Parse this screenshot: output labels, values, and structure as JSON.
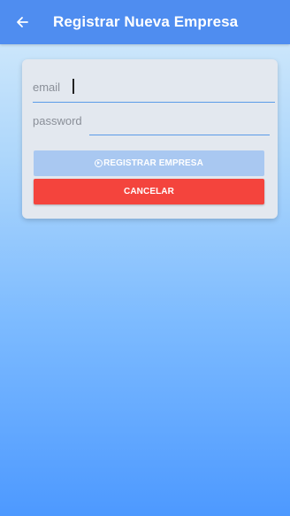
{
  "header": {
    "title": "Registrar Nueva Empresa",
    "back_icon": "arrow-left-icon"
  },
  "form": {
    "email": {
      "placeholder": "email",
      "value": ""
    },
    "password": {
      "placeholder": "password",
      "value": ""
    },
    "register_button": {
      "label": "REGISTRAR EMPRESA",
      "icon": "play-circle-icon",
      "disabled": true
    },
    "cancel_button": {
      "label": "CANCELAR"
    }
  },
  "colors": {
    "toolbar": "#4f8df0",
    "register_disabled": "#a9c8f1",
    "cancel": "#f4443d",
    "input_underline": "#5a9be8"
  }
}
